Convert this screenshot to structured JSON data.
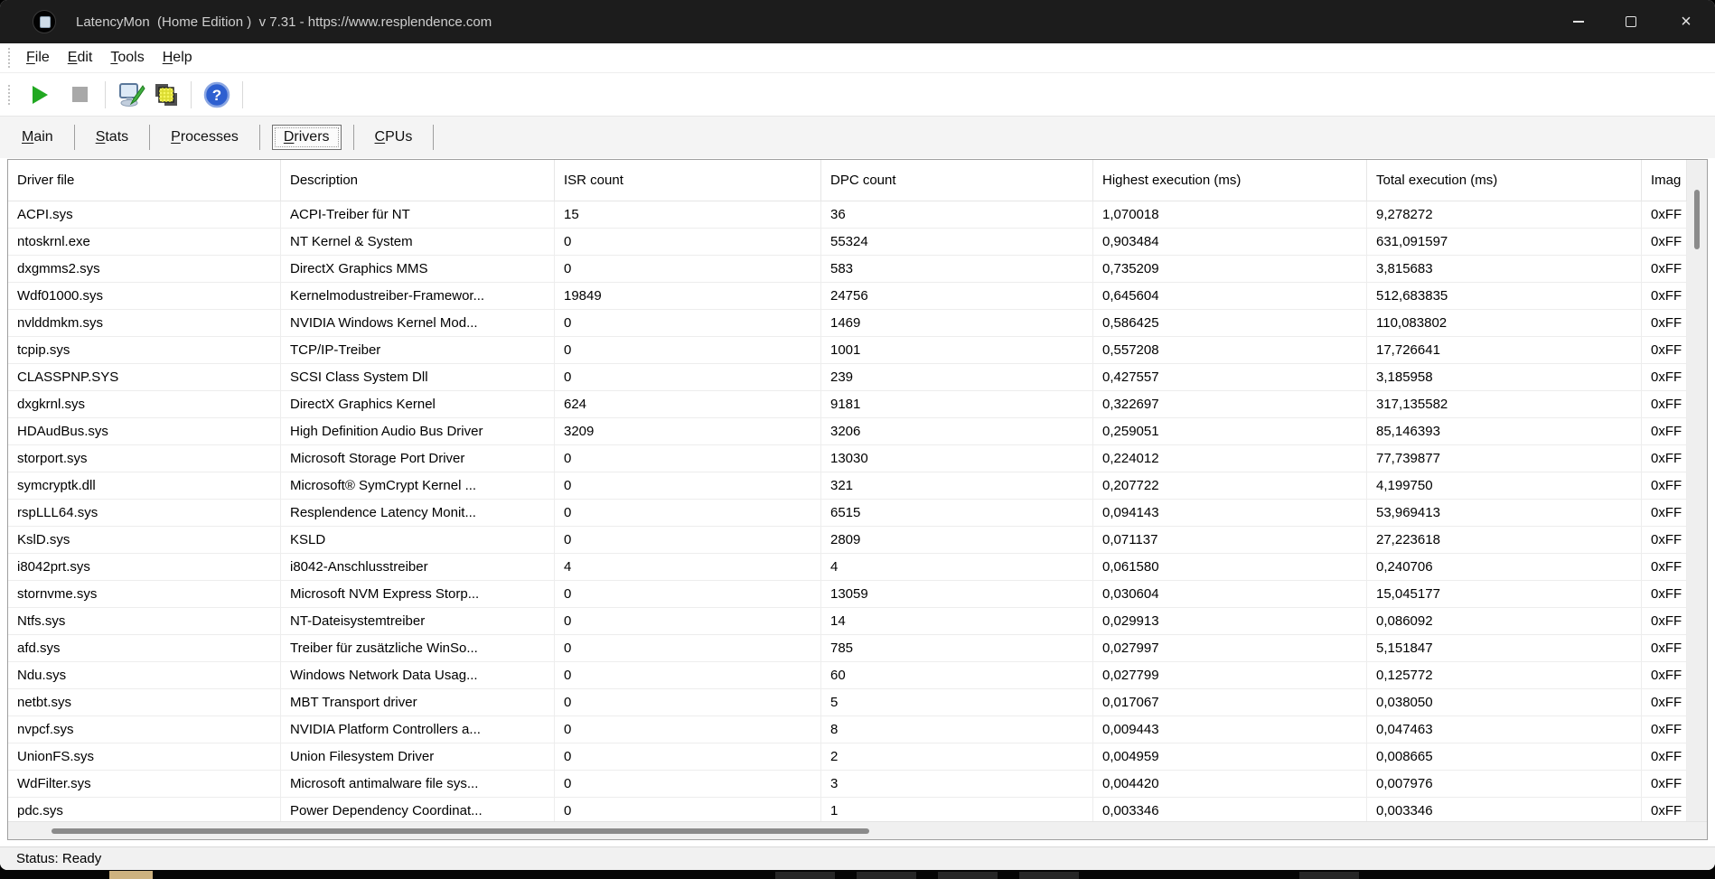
{
  "titlebar": {
    "title": "LatencyMon  (Home Edition )  v 7.31 - https://www.resplendence.com",
    "controls": {
      "minimize": "minimize-icon",
      "maximize": "maximize-icon",
      "close": "close-icon"
    }
  },
  "menu": {
    "items": [
      {
        "first": "F",
        "rest": "ile"
      },
      {
        "first": "E",
        "rest": "dit"
      },
      {
        "first": "T",
        "rest": "ools"
      },
      {
        "first": "H",
        "rest": "elp"
      }
    ]
  },
  "toolbar": {
    "buttons": [
      {
        "name": "start-button",
        "icon": "play-icon"
      },
      {
        "name": "stop-button",
        "icon": "stop-icon"
      },
      {
        "name": "options-button",
        "icon": "monitor-pen-icon"
      },
      {
        "name": "report-button",
        "icon": "report-icon"
      },
      {
        "name": "help-button",
        "icon": "help-icon"
      }
    ]
  },
  "tabs": {
    "selected": "Drivers",
    "items": [
      {
        "first": "M",
        "rest": "ain"
      },
      {
        "first": "S",
        "rest": "tats"
      },
      {
        "first": "P",
        "rest": "rocesses"
      },
      {
        "first": "D",
        "rest": "rivers"
      },
      {
        "first": "C",
        "rest": "PUs"
      }
    ]
  },
  "table": {
    "columns": [
      "Driver file",
      "Description",
      "ISR count",
      "DPC count",
      "Highest execution (ms)",
      "Total execution (ms)",
      "Imag"
    ],
    "rows": [
      [
        "ACPI.sys",
        "ACPI-Treiber für NT",
        "15",
        "36",
        "1,070018",
        "9,278272",
        "0xFF"
      ],
      [
        "ntoskrnl.exe",
        "NT Kernel & System",
        "0",
        "55324",
        "0,903484",
        "631,091597",
        "0xFF"
      ],
      [
        "dxgmms2.sys",
        "DirectX Graphics MMS",
        "0",
        "583",
        "0,735209",
        "3,815683",
        "0xFF"
      ],
      [
        "Wdf01000.sys",
        "Kernelmodustreiber-Framewor...",
        "19849",
        "24756",
        "0,645604",
        "512,683835",
        "0xFF"
      ],
      [
        "nvlddmkm.sys",
        "NVIDIA Windows Kernel Mod...",
        "0",
        "1469",
        "0,586425",
        "110,083802",
        "0xFF"
      ],
      [
        "tcpip.sys",
        "TCP/IP-Treiber",
        "0",
        "1001",
        "0,557208",
        "17,726641",
        "0xFF"
      ],
      [
        "CLASSPNP.SYS",
        "SCSI Class System Dll",
        "0",
        "239",
        "0,427557",
        "3,185958",
        "0xFF"
      ],
      [
        "dxgkrnl.sys",
        "DirectX Graphics Kernel",
        "624",
        "9181",
        "0,322697",
        "317,135582",
        "0xFF"
      ],
      [
        "HDAudBus.sys",
        "High Definition Audio Bus Driver",
        "3209",
        "3206",
        "0,259051",
        "85,146393",
        "0xFF"
      ],
      [
        "storport.sys",
        "Microsoft Storage Port Driver",
        "0",
        "13030",
        "0,224012",
        "77,739877",
        "0xFF"
      ],
      [
        "symcryptk.dll",
        "Microsoft® SymCrypt Kernel ...",
        "0",
        "321",
        "0,207722",
        "4,199750",
        "0xFF"
      ],
      [
        "rspLLL64.sys",
        "Resplendence Latency Monit...",
        "0",
        "6515",
        "0,094143",
        "53,969413",
        "0xFF"
      ],
      [
        "KslD.sys",
        "KSLD",
        "0",
        "2809",
        "0,071137",
        "27,223618",
        "0xFF"
      ],
      [
        "i8042prt.sys",
        "i8042-Anschlusstreiber",
        "4",
        "4",
        "0,061580",
        "0,240706",
        "0xFF"
      ],
      [
        "stornvme.sys",
        "Microsoft NVM Express Storp...",
        "0",
        "13059",
        "0,030604",
        "15,045177",
        "0xFF"
      ],
      [
        "Ntfs.sys",
        "NT-Dateisystemtreiber",
        "0",
        "14",
        "0,029913",
        "0,086092",
        "0xFF"
      ],
      [
        "afd.sys",
        "Treiber für zusätzliche WinSo...",
        "0",
        "785",
        "0,027997",
        "5,151847",
        "0xFF"
      ],
      [
        "Ndu.sys",
        "Windows Network Data Usag...",
        "0",
        "60",
        "0,027799",
        "0,125772",
        "0xFF"
      ],
      [
        "netbt.sys",
        "MBT Transport driver",
        "0",
        "5",
        "0,017067",
        "0,038050",
        "0xFF"
      ],
      [
        "nvpcf.sys",
        "NVIDIA Platform Controllers a...",
        "0",
        "8",
        "0,009443",
        "0,047463",
        "0xFF"
      ],
      [
        "UnionFS.sys",
        "Union Filesystem Driver",
        "0",
        "2",
        "0,004959",
        "0,008665",
        "0xFF"
      ],
      [
        "WdFilter.sys",
        "Microsoft antimalware file sys...",
        "0",
        "3",
        "0,004420",
        "0,007976",
        "0xFF"
      ],
      [
        "pdc.sys",
        "Power Dependency Coordinat...",
        "0",
        "1",
        "0,003346",
        "0,003346",
        "0xFF"
      ]
    ]
  },
  "status": {
    "text": "Status: Ready"
  },
  "colors": {
    "titlebar_bg": "#1c1c1c",
    "play_green": "#21a821",
    "stop_gray": "#a8a8a8",
    "help_blue": "#2d5fd0",
    "status_bg": "#f1f1f1"
  }
}
